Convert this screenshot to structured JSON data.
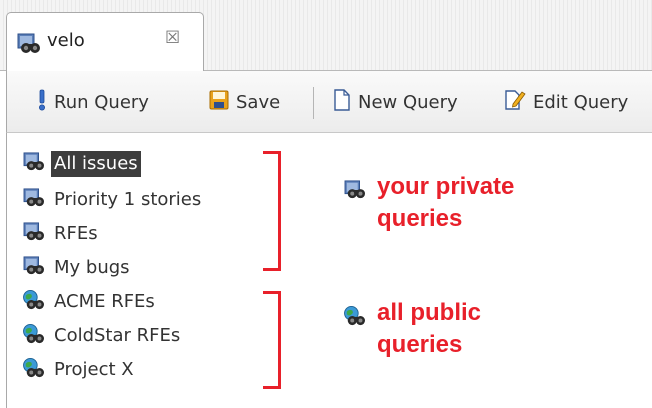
{
  "tab": {
    "title": "velo",
    "icon": "binoculars-private-icon",
    "close_icon": "close-icon"
  },
  "toolbar": {
    "run_query": {
      "label": "Run Query",
      "icon": "exclamation-icon"
    },
    "save": {
      "label": "Save",
      "icon": "floppy-disk-icon"
    },
    "new_query": {
      "label": "New Query",
      "icon": "new-document-icon"
    },
    "edit_query": {
      "label": "Edit Query",
      "icon": "edit-document-icon"
    }
  },
  "queries": {
    "private": [
      {
        "label": "All issues",
        "selected": true
      },
      {
        "label": "Priority 1 stories"
      },
      {
        "label": "RFEs"
      },
      {
        "label": "My bugs"
      }
    ],
    "public": [
      {
        "label": "ACME RFEs"
      },
      {
        "label": "ColdStar RFEs"
      },
      {
        "label": "Project X"
      }
    ]
  },
  "annotations": {
    "private_line1": "your private",
    "private_line2": "queries",
    "public_line1": "all public",
    "public_line2": "queries",
    "color": "#e8202a"
  }
}
